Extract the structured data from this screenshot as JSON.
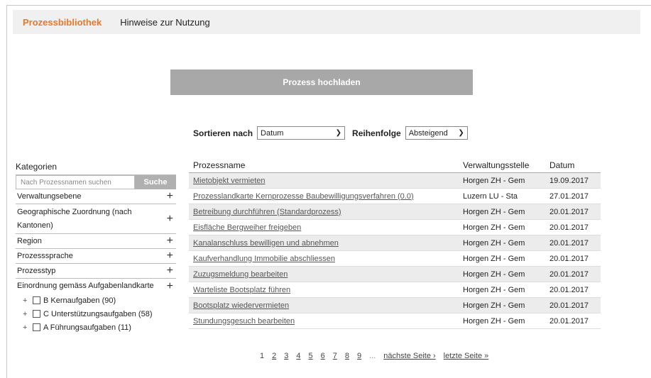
{
  "nav": {
    "tabs": [
      "Prozessbibliothek",
      "Hinweise zur Nutzung"
    ]
  },
  "upload_label": "Prozess hochladen",
  "sort": {
    "sort_label": "Sortieren nach",
    "sort_value": "Datum",
    "order_label": "Reihenfolge",
    "order_value": "Absteigend"
  },
  "sidebar": {
    "title": "Kategorien",
    "search_placeholder": "Nach Prozessnamen suchen",
    "search_button": "Suche",
    "categories": [
      "Verwaltungsebene",
      "Geographische Zuordnung (nach Kantonen)",
      "Region",
      "Prozesssprache",
      "Prozesstyp",
      "Einordnung gemäss Aufgabenlandkarte"
    ],
    "subitems": [
      "B Kernaufgaben (90)",
      "C Unterstützungsaufgaben (58)",
      "A Führungsaufgaben (11)"
    ]
  },
  "table": {
    "headers": [
      "Prozessname",
      "Verwaltungsstelle",
      "Datum"
    ],
    "rows": [
      [
        "Mietobjekt vermieten",
        "Horgen ZH - Gem",
        "19.09.2017"
      ],
      [
        "Prozesslandkarte Kernprozesse Baubewilligungsverfahren (0.0)",
        "Luzern LU - Sta",
        "27.01.2017"
      ],
      [
        "Betreibung durchführen (Standardprozess)",
        "Horgen ZH - Gem",
        "20.01.2017"
      ],
      [
        "Eisfläche Bergweiher freigeben",
        "Horgen ZH - Gem",
        "20.01.2017"
      ],
      [
        "Kanalanschluss bewilligen und abnehmen",
        "Horgen ZH - Gem",
        "20.01.2017"
      ],
      [
        "Kaufverhandlung Immobilie abschliessen",
        "Horgen ZH - Gem",
        "20.01.2017"
      ],
      [
        "Zuzugsmeldung bearbeiten",
        "Horgen ZH - Gem",
        "20.01.2017"
      ],
      [
        "Warteliste Bootsplatz führen",
        "Horgen ZH - Gem",
        "20.01.2017"
      ],
      [
        "Bootsplatz wiedervermieten",
        "Horgen ZH - Gem",
        "20.01.2017"
      ],
      [
        "Stundungsgesuch bearbeiten",
        "Horgen ZH - Gem",
        "20.01.2017"
      ]
    ]
  },
  "pager": {
    "current": "1",
    "pages": [
      "2",
      "3",
      "4",
      "5",
      "6",
      "7",
      "8",
      "9"
    ],
    "ellipsis": "...",
    "next": "nächste Seite ›",
    "last": "letzte Seite »"
  }
}
